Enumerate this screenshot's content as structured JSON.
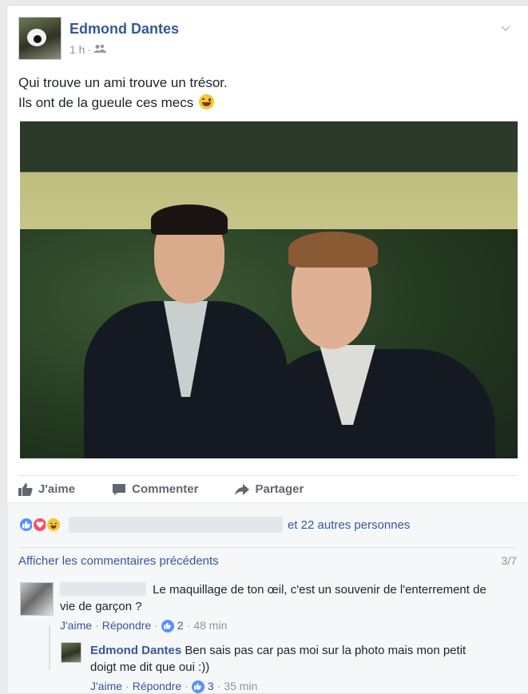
{
  "post": {
    "author": "Edmond Dantes",
    "time": "1 h",
    "separator": "·",
    "text_line1": "Qui trouve un ami trouve un trésor.",
    "text_line2": "Ils ont de la gueule ces mecs"
  },
  "actions": {
    "like": "J'aime",
    "comment": "Commenter",
    "share": "Partager"
  },
  "reactions": {
    "summary_suffix": "et 22 autres personnes"
  },
  "comments_section": {
    "show_previous": "Afficher les commentaires précédents",
    "count": "3/7"
  },
  "comments": [
    {
      "text_line1": "Le maquillage de ton œil, c'est un souvenir de l'enterrement de",
      "text_line2": "vie de garçon ?",
      "like": "J'aime",
      "reply": "Répondre",
      "likes": "2",
      "time": "48 min"
    },
    {
      "author": "Edmond Dantes",
      "text_line1": "Ben sais pas car pas moi sur la photo mais mon petit",
      "text_line2": "doigt me dit que oui :))",
      "like": "J'aime",
      "reply": "Répondre",
      "likes": "3",
      "time": "35 min"
    }
  ],
  "colors": {
    "link_blue": "#365899",
    "meta_gray": "#90949c",
    "like_blue": "#5890ff",
    "love_red": "#f25268",
    "haha_yellow": "#f7c531"
  },
  "icons": [
    "friends-icon",
    "chevron-down-icon",
    "thumb-up-icon",
    "comment-icon",
    "share-icon",
    "like-reaction-icon",
    "love-reaction-icon",
    "haha-reaction-icon",
    "laughing-emoji-icon"
  ]
}
